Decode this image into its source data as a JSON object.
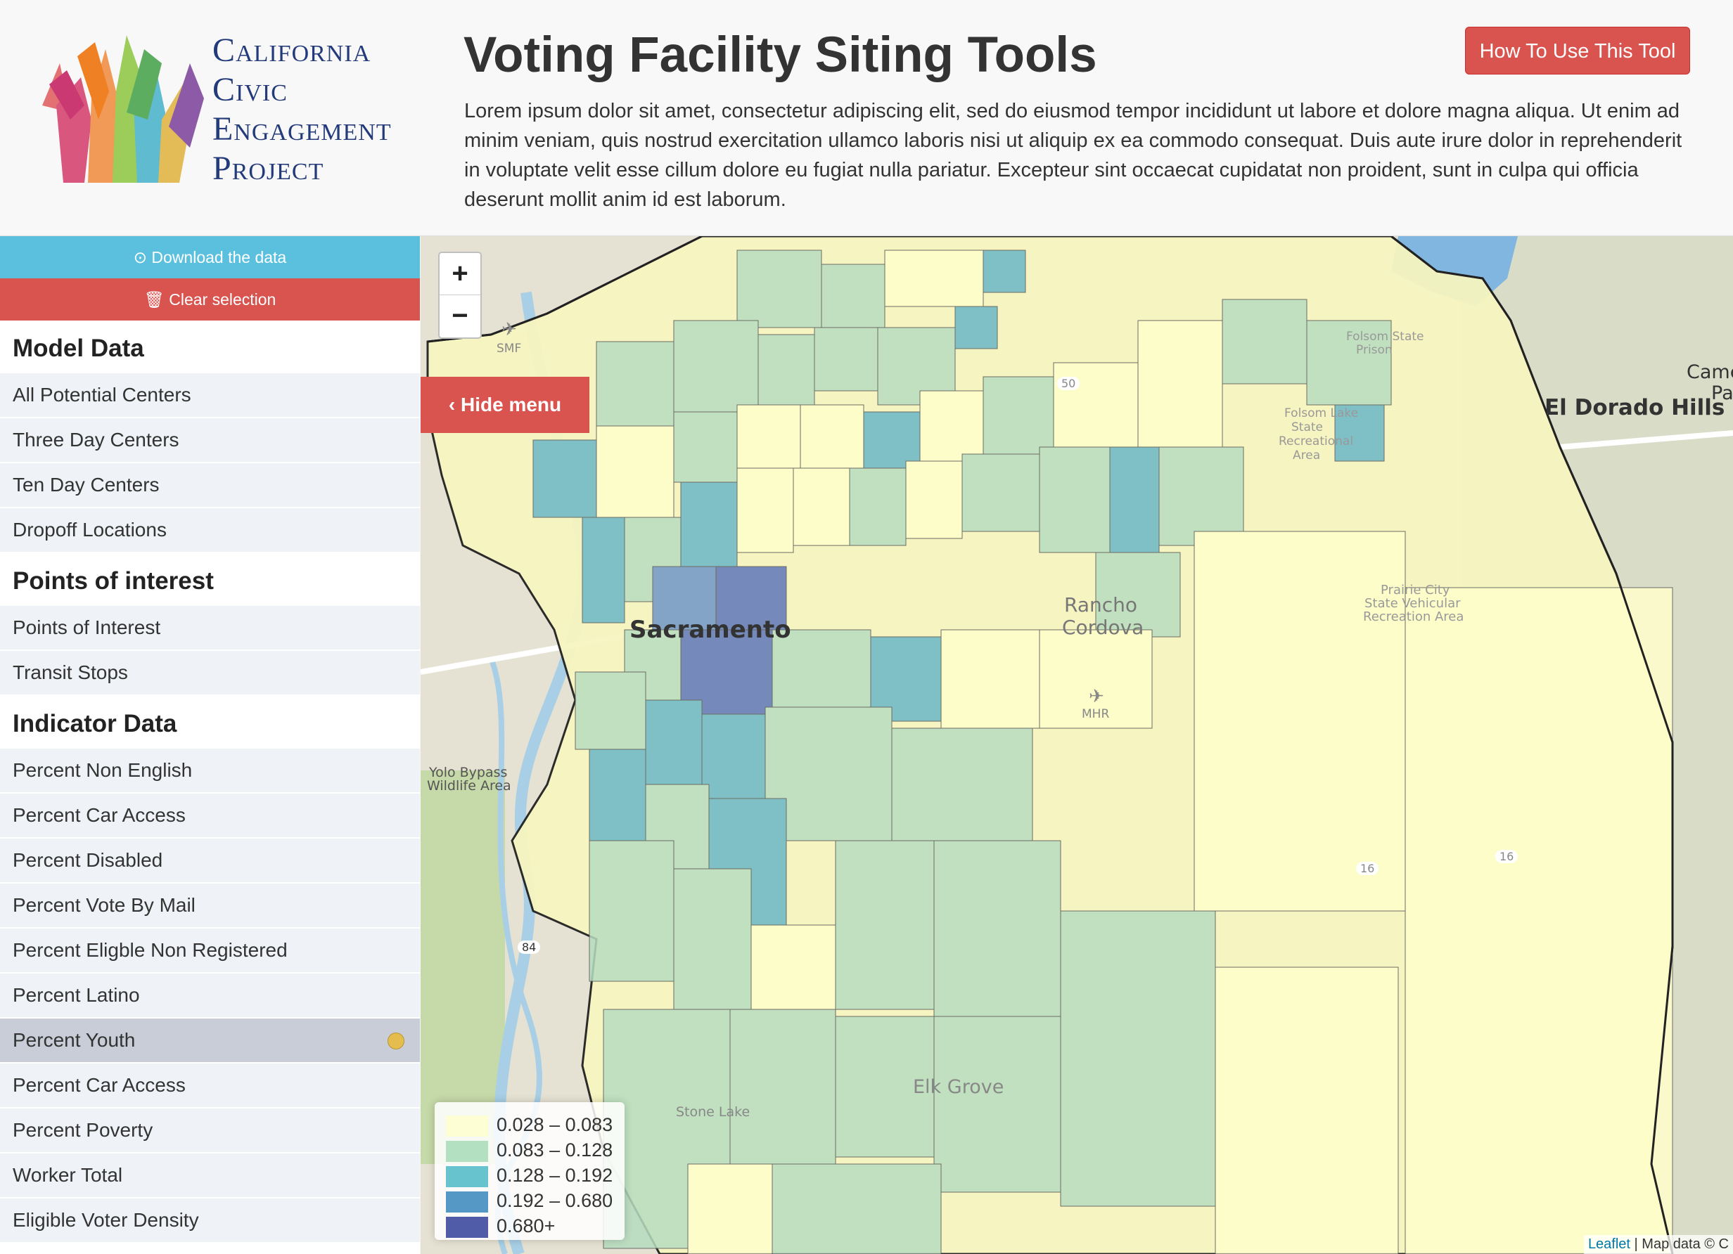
{
  "header": {
    "logo": {
      "line1": "California",
      "line2": "Civic",
      "line3": "Engagement",
      "line4": "Project"
    },
    "title": "Voting Facility Siting Tools",
    "description": "Lorem ipsum dolor sit amet, consectetur adipiscing elit, sed do eiusmod tempor incididunt ut labore et dolore magna aliqua. Ut enim ad minim veniam, quis nostrud exercitation ullamco laboris nisi ut aliquip ex ea commodo consequat. Duis aute irure dolor in reprehenderit in voluptate velit esse cillum dolore eu fugiat nulla pariatur. Excepteur sint occaecat cupidatat non proident, sunt in culpa qui officia deserunt mollit anim id est laborum.",
    "how_button": "How To Use This Tool"
  },
  "sidebar": {
    "download_label": "Download the data",
    "clear_label": "Clear selection",
    "sections": [
      {
        "title": "Model Data",
        "items": [
          "All Potential Centers",
          "Three Day Centers",
          "Ten Day Centers",
          "Dropoff Locations"
        ]
      },
      {
        "title": "Points of interest",
        "items": [
          "Points of Interest",
          "Transit Stops"
        ]
      },
      {
        "title": "Indicator Data",
        "items": [
          "Percent Non English",
          "Percent Car Access",
          "Percent Disabled",
          "Percent Vote By Mail",
          "Percent Eligble Non Registered",
          "Percent Latino",
          "Percent Youth",
          "Percent Car Access",
          "Percent Poverty",
          "Worker Total",
          "Eligible Voter Density"
        ]
      }
    ],
    "active_item": "Percent Youth",
    "active_color": "#e5bd4e"
  },
  "map": {
    "zoom_in": "+",
    "zoom_out": "−",
    "hide_menu_label": "Hide menu",
    "place_labels": {
      "sacramento": "Sacramento",
      "el_dorado_hills": "El Dorado Hills",
      "cameron_park": "Came",
      "cameron_park_2": "Pa",
      "rancho_cordova": "Rancho",
      "rancho_cordova_2": "Cordova",
      "elk_grove": "Elk Grove",
      "stone_lake": "Stone Lake",
      "yolo_bypass": "Yolo Bypass",
      "yolo_bypass_2": "Wildlife Area",
      "prairie_city": "Prairie City",
      "prairie_city_2": "State Vehicular",
      "prairie_city_3": "Recreation Area",
      "folsom_lake": "Folsom Lake",
      "folsom_lake_2": "State",
      "folsom_lake_3": "Recreational",
      "folsom_lake_4": "Area",
      "folsom_prison": "Folsom State",
      "folsom_prison_2": "Prison",
      "smf": "SMF",
      "mhr": "MHR",
      "hwy_84": "84",
      "hwy_16a": "16",
      "hwy_16b": "16",
      "hwy_50": "50"
    },
    "legend": [
      {
        "label": "0.028 – 0.083",
        "color": "#ffffcc"
      },
      {
        "label": "0.083 – 0.128",
        "color": "#a1dab4"
      },
      {
        "label": "0.128 – 0.192",
        "color": "#41b6c4"
      },
      {
        "label": "0.192 – 0.680",
        "color": "#2c7fb8"
      },
      {
        "label": "0.680+",
        "color": "#253494"
      }
    ],
    "attribution_link": "Leaflet",
    "attribution_text": " | Map data © C"
  }
}
